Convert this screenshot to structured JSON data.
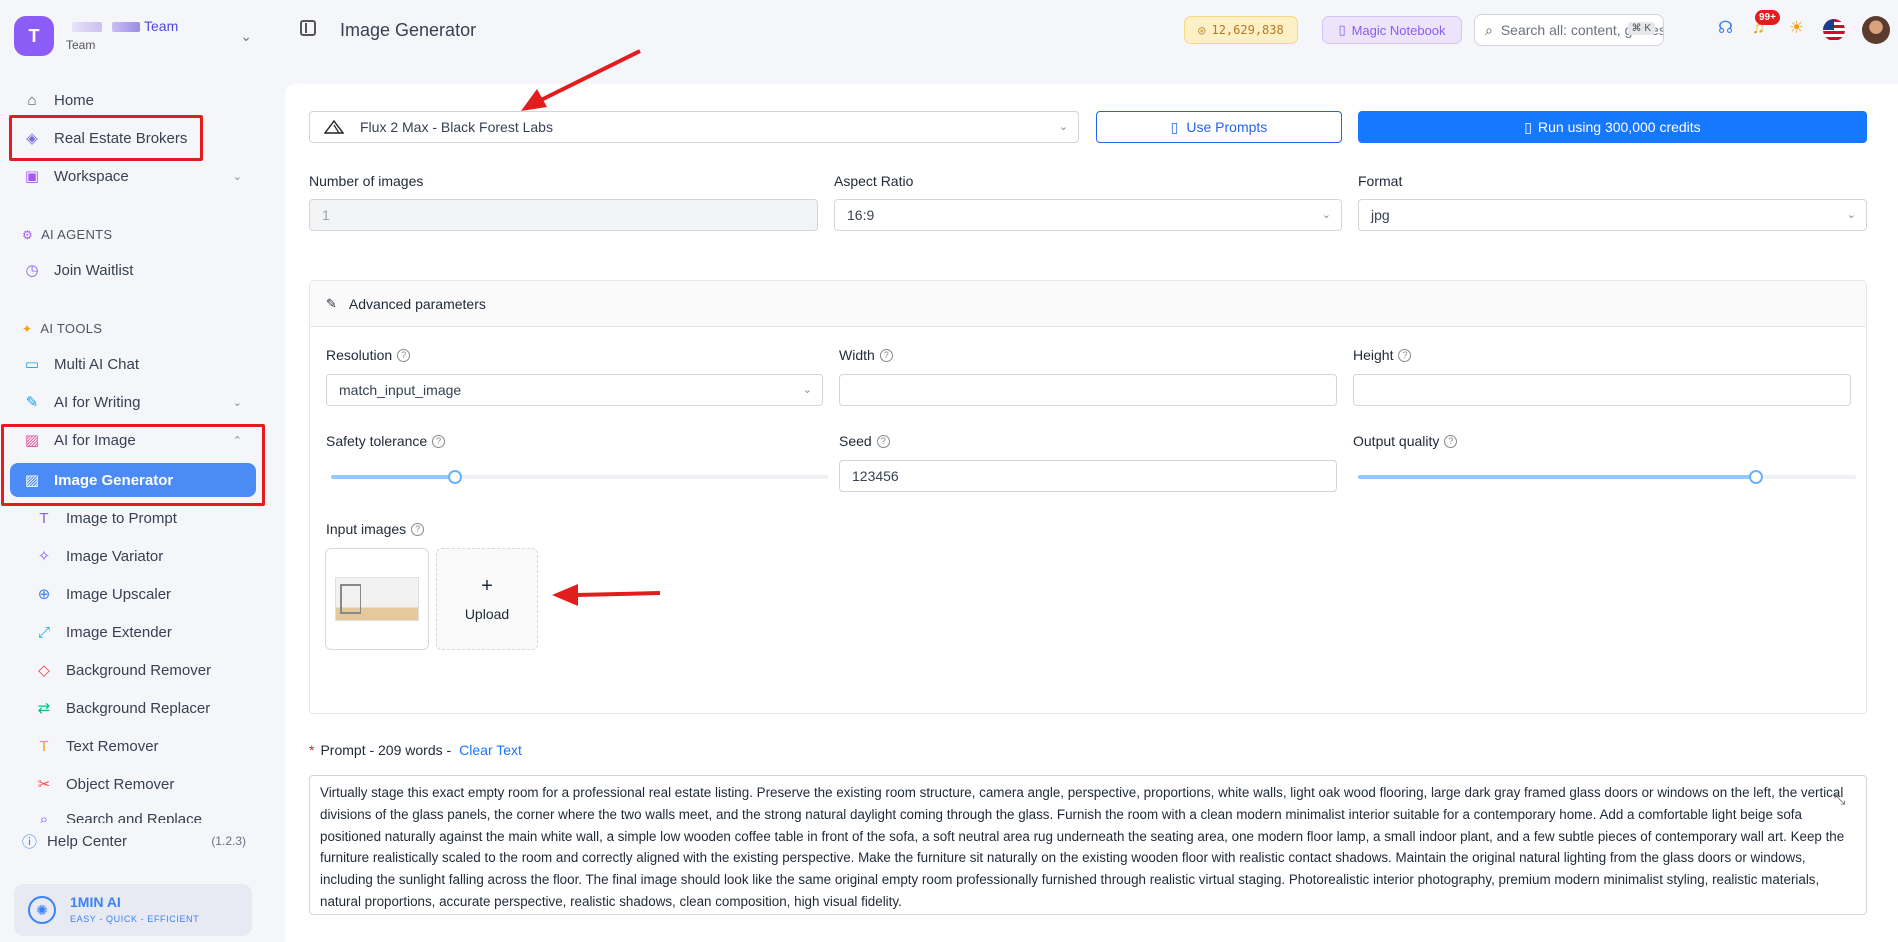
{
  "team": {
    "avatar_letter": "T",
    "name": "Team",
    "sub": "Team"
  },
  "sidebar": {
    "items": [
      {
        "label": "Home",
        "icon": "home-icon"
      },
      {
        "label": "Real Estate Brokers",
        "icon": "layers-icon"
      },
      {
        "label": "Workspace",
        "icon": "briefcase-icon"
      }
    ],
    "agents_label": "AI AGENTS",
    "join_waitlist": "Join Waitlist",
    "tools_label": "AI TOOLS",
    "tools": [
      {
        "label": "Multi AI Chat"
      },
      {
        "label": "AI for Writing"
      },
      {
        "label": "AI for Image"
      }
    ],
    "image_tools": [
      {
        "label": "Image Generator"
      },
      {
        "label": "Image to Prompt"
      },
      {
        "label": "Image Variator"
      },
      {
        "label": "Image Upscaler"
      },
      {
        "label": "Image Extender"
      },
      {
        "label": "Background Remover"
      },
      {
        "label": "Background Replacer"
      },
      {
        "label": "Text Remover"
      },
      {
        "label": "Object Remover"
      },
      {
        "label": "Search and Replace"
      }
    ],
    "help": "Help Center",
    "version": "(1.2.3)",
    "brand_name": "1MIN AI",
    "brand_tagline": "EASY - QUICK - EFFICIENT"
  },
  "header": {
    "title": "Image Generator",
    "credits": "12,629,838",
    "notebook": "Magic Notebook",
    "search_placeholder": "Search all: content, guides...",
    "search_kbd": "⌘ K",
    "notifications": "99+"
  },
  "generator": {
    "model": "Flux 2 Max - Black Forest Labs",
    "use_prompts": "Use Prompts",
    "run_button": "Run using 300,000 credits",
    "num_images_label": "Number of images",
    "num_images_value": "1",
    "aspect_label": "Aspect Ratio",
    "aspect_value": "16:9",
    "format_label": "Format",
    "format_value": "jpg"
  },
  "advanced": {
    "title": "Advanced parameters",
    "resolution_label": "Resolution",
    "resolution_value": "match_input_image",
    "width_label": "Width",
    "height_label": "Height",
    "safety_label": "Safety tolerance",
    "safety_level_fraction": 0.25,
    "seed_label": "Seed",
    "seed_value": "123456",
    "quality_label": "Output quality",
    "quality_level_fraction": 0.8,
    "input_images_label": "Input images",
    "upload_label": "Upload"
  },
  "prompt": {
    "label": "Prompt - 209 words -",
    "clear": "Clear Text",
    "text": "Virtually stage this exact empty room for a professional real estate listing. Preserve the existing room structure, camera angle, perspective, proportions, white walls, light oak wood flooring, large dark gray framed glass doors or windows on the left, the vertical divisions of the glass panels, the corner where the two walls meet, and the strong natural daylight coming through the glass. Furnish the room with a clean modern minimalist interior suitable for a contemporary home. Add a comfortable light beige sofa positioned naturally against the main white wall, a simple low wooden coffee table in front of the sofa, a soft neutral area rug underneath the seating area, one modern floor lamp, a small indoor plant, and a few subtle pieces of contemporary wall art. Keep the furniture realistically scaled to the room and correctly aligned with the existing perspective. Make the furniture sit naturally on the existing wooden floor with realistic contact shadows. Maintain the original natural lighting from the glass doors or windows, including the sunlight falling across the floor. The final image should look like the same original empty room professionally furnished through realistic virtual staging. Photorealistic interior photography, premium modern minimalist styling, realistic materials, natural proportions, accurate perspective, realistic shadows, clean composition, high visual fidelity."
  },
  "colors": {
    "accent": "#1677ff",
    "active_nav": "#4c8bf5",
    "annotation_red": "#e11d1d"
  }
}
